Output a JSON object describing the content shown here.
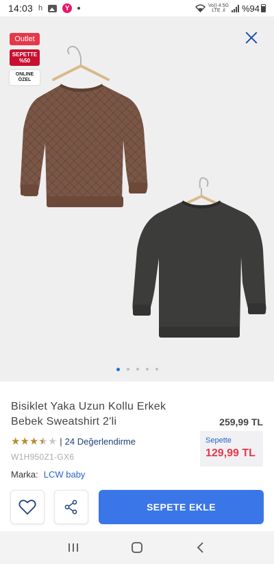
{
  "status_bar": {
    "time": "14:03",
    "indicator": "h",
    "app_badge": "Y",
    "network_top": "Vo)) 4.5G",
    "network_bottom": "LTE .il",
    "battery": "%94"
  },
  "gallery": {
    "badges": {
      "outlet": "Outlet",
      "sepette_line1": "SEPETTE",
      "sepette_line2": "%50",
      "online_line1": "ONLINE",
      "online_line2": "ÖZEL"
    },
    "page_count": 5,
    "active_page": 0,
    "colors": {
      "brown_sweatshirt": "#7a5646",
      "dark_sweatshirt": "#3c3d3a",
      "background": "#efefef"
    }
  },
  "product": {
    "title": "Bisiklet Yaka Uzun Kollu Erkek Bebek Sweatshirt 2'li",
    "old_price": "259,99 TL",
    "rating_value": 3.5,
    "rating_max": 5,
    "rating_sep": "|",
    "reviews_link": "24 Değerlendirme",
    "sku": "W1H950Z1-GX6",
    "brand_label": "Marka:",
    "brand_name": "LCW baby",
    "sepette_label": "Sepette",
    "sepette_price": "129,99 TL"
  },
  "actions": {
    "favorite_icon": "heart-icon",
    "share_icon": "share-icon",
    "add_to_cart": "SEPETE EKLE",
    "accent_color": "#3b76e8"
  },
  "navbar": {
    "recents_icon": "recents-icon",
    "home_icon": "home-icon",
    "back_icon": "back-icon"
  }
}
